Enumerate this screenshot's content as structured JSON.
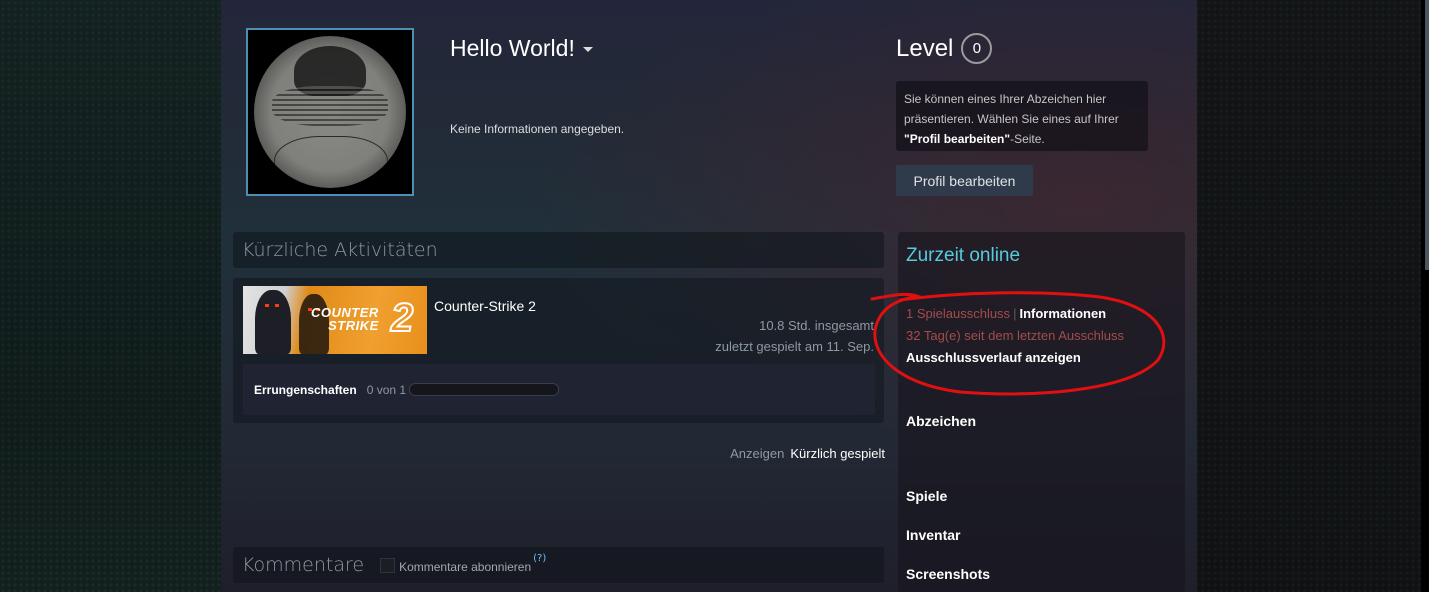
{
  "profile": {
    "persona_name": "Hello World!",
    "summary": "Keine Informationen angegeben.",
    "level_label": "Level",
    "level_value": "0",
    "badge_hint_part1": "Sie können eines Ihrer Abzeichen hier präsentieren. Wählen Sie eines auf Ihrer ",
    "badge_hint_bold": "\"Profil bearbeiten\"",
    "badge_hint_part2": "-Seite.",
    "edit_button": "Profil bearbeiten"
  },
  "activity": {
    "title": "Kürzliche Aktivitäten",
    "game": {
      "name": "Counter-Strike 2",
      "capsule_line1": "COUNTER",
      "capsule_line2": "STRIKE",
      "capsule_number": "2",
      "hours": "10.8 Std. insgesamt",
      "last_played": "zuletzt gespielt am 11. Sep.",
      "achievements_label": "Errungenschaften",
      "achievements_count": "0 von 1",
      "achievements_progress": 0
    },
    "view_label": "Anzeigen",
    "view_value": "Kürzlich gespielt"
  },
  "comments": {
    "title": "Kommentare",
    "subscribe_label": "Kommentare abonnieren",
    "help": "(?)"
  },
  "sidebar": {
    "status": "Zurzeit online",
    "ban_count": "1 Spielausschluss",
    "ban_separator": "|",
    "ban_info": "Informationen",
    "ban_days": "32 Tag(e) seit dem letzten Ausschluss",
    "ban_history": "Ausschlussverlauf anzeigen",
    "links": [
      "Abzeichen",
      "Spiele",
      "Inventar",
      "Screenshots"
    ]
  },
  "colors": {
    "accent_online": "#57cbde",
    "ban_red": "#a34c4c",
    "annotation_red": "#e01010"
  }
}
